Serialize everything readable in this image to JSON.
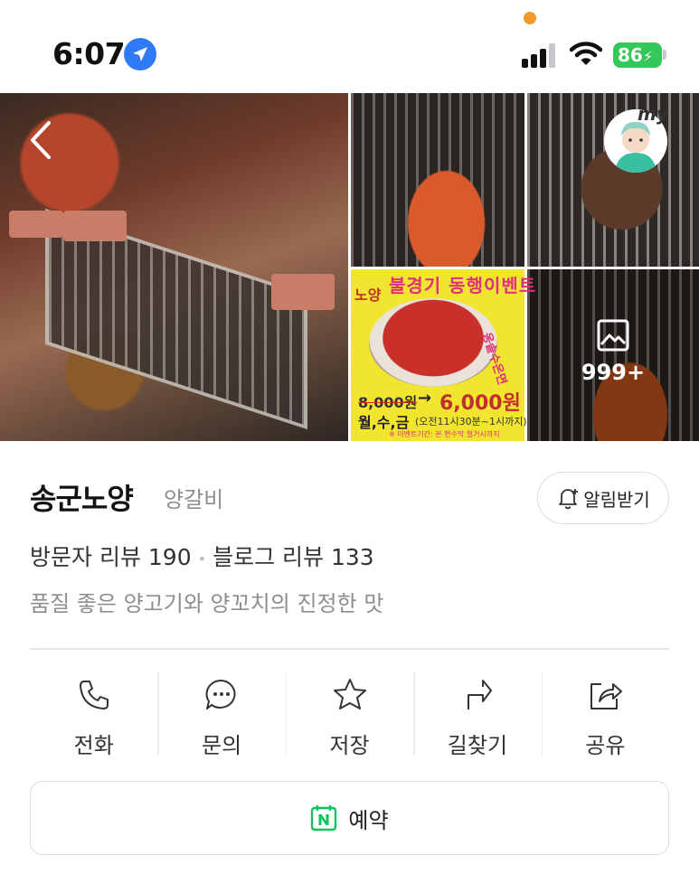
{
  "status_bar": {
    "time": "6:07",
    "battery": "86"
  },
  "photos": {
    "more_count": "999+",
    "avatar_label": "my",
    "event_poster": {
      "logo": "노양",
      "title": "불경기 동행이벤트",
      "side_text": "옹솥수온면",
      "old_price": "8,000원",
      "arrow": "→",
      "new_price": "6,000원",
      "days": "월,수,금",
      "hours": "(오전11시30분~1시까지)",
      "period": "※ 이벤트기간: 본 현수막 철거시까지"
    }
  },
  "place": {
    "name": "송군노양",
    "category": "양갈비",
    "notify_label": "알림받기",
    "visitor_reviews": "방문자 리뷰 190",
    "separator": "•",
    "blog_reviews": "블로그 리뷰 133",
    "description": "품질 좋은 양고기와 양꼬치의 진정한 맛"
  },
  "actions": [
    {
      "label": "전화",
      "icon": "phone-icon"
    },
    {
      "label": "문의",
      "icon": "chat-icon"
    },
    {
      "label": "저장",
      "icon": "star-icon"
    },
    {
      "label": "길찾기",
      "icon": "directions-icon"
    },
    {
      "label": "공유",
      "icon": "share-icon"
    }
  ],
  "reserve": {
    "label": "예약",
    "icon": "naver-icon"
  },
  "colors": {
    "accent_green": "#03c75a",
    "battery_green": "#34c759",
    "location_blue": "#2f7bf5",
    "notification_dot": "#f39a2b",
    "poster_yellow": "#f2e530"
  }
}
